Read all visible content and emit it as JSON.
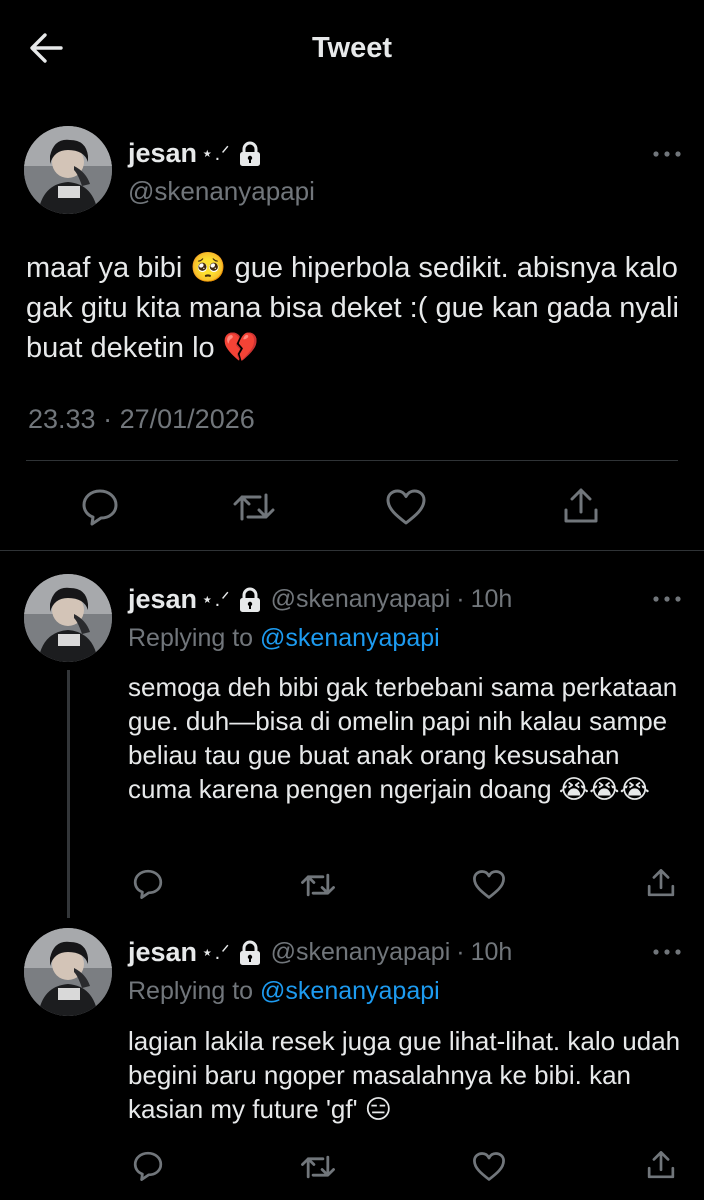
{
  "header": {
    "title": "Tweet"
  },
  "main_tweet": {
    "display_name": "jesan",
    "name_decoration": "⋆.ᐟ",
    "handle": "@skenanyapapi",
    "text": "maaf ya bibi 🥺 gue hiperbola sedikit. abisnya kalo gak gitu kita mana bisa deket :( gue kan gada nyali buat deketin lo 💔",
    "time": "23.33",
    "separator": "·",
    "date": "27/01/2026"
  },
  "replies": [
    {
      "display_name": "jesan",
      "name_decoration": "⋆.ᐟ",
      "handle": "@skenanyapapi",
      "separator": "·",
      "age": "10h",
      "replying_label": "Replying to",
      "replying_to": "@skenanyapapi",
      "text": "semoga deh bibi gak terbebani sama perkataan gue. duh—bisa di omelin papi nih kalau sampe beliau tau gue buat anak orang kesusahan cuma karena pengen ngerjain doang 😭😭😭"
    },
    {
      "display_name": "jesan",
      "name_decoration": "⋆.ᐟ",
      "handle": "@skenanyapapi",
      "separator": "·",
      "age": "10h",
      "replying_label": "Replying to",
      "replying_to": "@skenanyapapi",
      "text": "lagian lakila resek juga gue lihat-lihat. kalo udah begini baru ngoper masalahnya ke bibi. kan kasian my future 'gf' 😑"
    }
  ],
  "icons": {
    "back": "arrow-left-icon",
    "lock": "lock-icon",
    "more": "more-horizontal-icon",
    "reply": "reply-icon",
    "retweet": "retweet-icon",
    "like": "heart-icon",
    "share": "share-icon"
  },
  "colors": {
    "background": "#000000",
    "text": "#e7e9ea",
    "secondary": "#71767b",
    "accent": "#1d9bf0",
    "divider": "#2f3336"
  }
}
